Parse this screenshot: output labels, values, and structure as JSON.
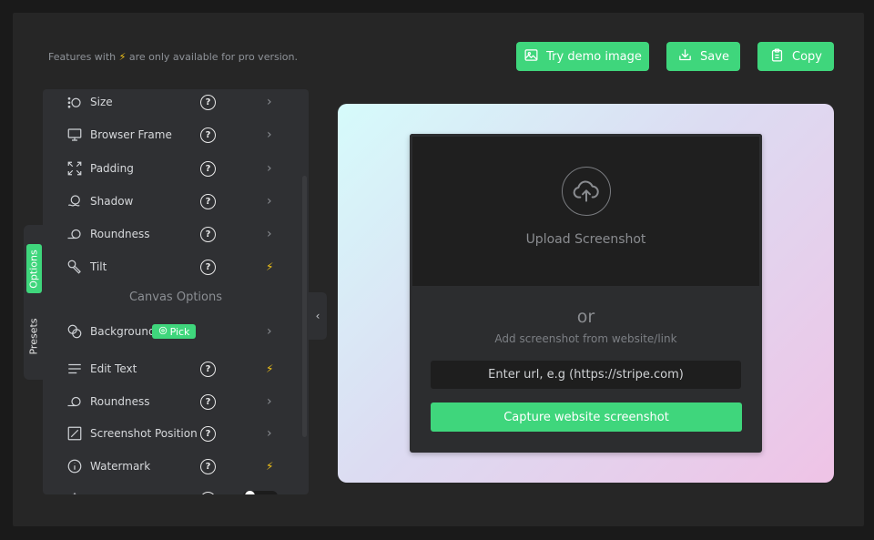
{
  "header": {
    "notice_before": "Features with",
    "notice_after": "are only available for pro version.",
    "try_demo_label": "Try demo image",
    "save_label": "Save",
    "copy_label": "Copy"
  },
  "side_tabs": {
    "options": "Options",
    "presets": "Presets"
  },
  "options": {
    "items": [
      {
        "label": "Size",
        "end": "chevron"
      },
      {
        "label": "Browser Frame",
        "end": "chevron"
      },
      {
        "label": "Padding",
        "end": "chevron"
      },
      {
        "label": "Shadow",
        "end": "chevron"
      },
      {
        "label": "Roundness",
        "end": "chevron"
      },
      {
        "label": "Tilt",
        "end": "pro"
      }
    ],
    "canvas_section": "Canvas Options",
    "canvas_items": [
      {
        "label": "Background",
        "badge": "Pick",
        "end": "chevron"
      },
      {
        "label": "Edit Text",
        "end": "pro"
      },
      {
        "label": "Roundness",
        "end": "chevron"
      },
      {
        "label": "Screenshot Position",
        "end": "chevron"
      },
      {
        "label": "Watermark",
        "end": "pro"
      }
    ]
  },
  "icons": {
    "pro": "⚡",
    "chevron": "›",
    "collapse": "‹",
    "help": "?"
  },
  "upload": {
    "label": "Upload Screenshot",
    "or": "or",
    "sub": "Add screenshot from website/link",
    "url_placeholder": "Enter url, e.g (https://stripe.com)",
    "capture_label": "Capture website screenshot"
  },
  "colors": {
    "accent": "#3fd67c",
    "bolt": "#f5c518",
    "panel": "#2f3033"
  }
}
